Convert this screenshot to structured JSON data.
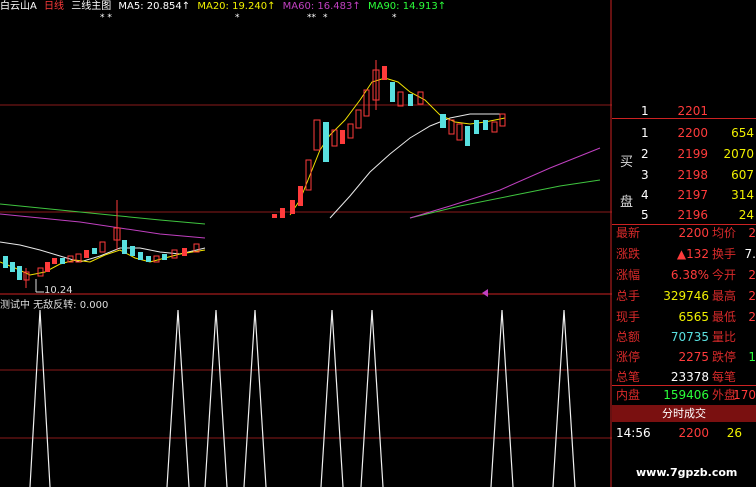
{
  "header": {
    "stock_name": "白云山A",
    "period": "日线",
    "indicator_name": "三线主图",
    "ma5": "MA5: 20.854↑",
    "ma20": "MA20: 19.240↑",
    "ma60": "MA60: 16.483↑",
    "ma90": "MA90: 14.913↑"
  },
  "chart": {
    "low_label": "10.24",
    "sub_indicator": "测试中 无敌反转: 0.000",
    "watermark": "www.7gpzb.com"
  },
  "chart_data": {
    "type": "candlestick",
    "sub_chart": {
      "type": "signal_spikes",
      "name": "无敌反转",
      "current_value": 0.0
    }
  },
  "order_book": {
    "buy_label_1": "买",
    "buy_label_2": "盘",
    "partial_top": "2201",
    "rows": [
      {
        "level": "1",
        "price": "2200",
        "volume": "654"
      },
      {
        "level": "2",
        "price": "2199",
        "volume": "2070"
      },
      {
        "level": "3",
        "price": "2198",
        "volume": "607"
      },
      {
        "level": "4",
        "price": "2197",
        "volume": "314"
      },
      {
        "level": "5",
        "price": "2196",
        "volume": "24"
      }
    ]
  },
  "quote": {
    "rows": [
      {
        "l1": "最新",
        "v1": "2200",
        "l2": "均价",
        "v2": "2"
      },
      {
        "l1": "涨跌",
        "v1": "▲132",
        "l2": "换手",
        "v2": "7."
      },
      {
        "l1": "涨幅",
        "v1": "6.38%",
        "l2": "今开",
        "v2": "2"
      },
      {
        "l1": "总手",
        "v1": "329746",
        "l2": "最高",
        "v2": "2"
      },
      {
        "l1": "现手",
        "v1": "6565",
        "l2": "最低",
        "v2": "2"
      },
      {
        "l1": "总额",
        "v1": "70735",
        "l2": "量比",
        "v2": ""
      },
      {
        "l1": "涨停",
        "v1": "2275",
        "l2": "跌停",
        "v2": "1"
      },
      {
        "l1": "总笔",
        "v1": "23378",
        "l2": "每笔",
        "v2": ""
      },
      {
        "l1": "内盘",
        "v1": "159406",
        "l2": "外盘",
        "v2": "170"
      }
    ],
    "tab_label": "分时成交",
    "trade_time": "14:56",
    "trade_price": "2200",
    "trade_volume": "26"
  }
}
